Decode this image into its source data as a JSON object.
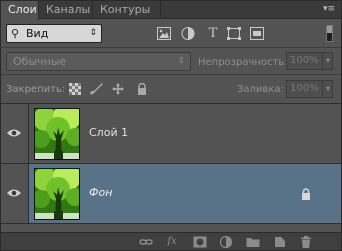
{
  "tabs": [
    {
      "label": "Слои",
      "active": true
    },
    {
      "label": "Каналы",
      "active": false
    },
    {
      "label": "Контуры",
      "active": false
    }
  ],
  "panel_menu_icon": "panel-menu-icon",
  "filter": {
    "kind_label": "Вид",
    "icons": [
      "pixel-layer-filter-icon",
      "adjustment-layer-filter-icon",
      "type-layer-filter-icon",
      "shape-layer-filter-icon",
      "smart-object-filter-icon"
    ]
  },
  "blend": {
    "mode": "Обычные",
    "opacity_label": "Непрозрачность:",
    "opacity_value": "100%"
  },
  "lock": {
    "label": "Закрепить:",
    "fill_label": "Заливка:",
    "fill_value": "100%"
  },
  "layers": [
    {
      "name": "Слой 1",
      "visible": true,
      "selected": false,
      "locked": false
    },
    {
      "name": "Фон",
      "visible": true,
      "selected": true,
      "locked": true
    }
  ],
  "footer_icons": [
    "link-layers-icon",
    "fx-icon",
    "layer-mask-icon",
    "adjustment-layer-icon",
    "group-folder-icon",
    "new-layer-icon",
    "trash-icon"
  ],
  "colors": {
    "panel_bg": "#535353",
    "selected_layer": "#587287",
    "tab_bar": "#3a3a3a"
  }
}
